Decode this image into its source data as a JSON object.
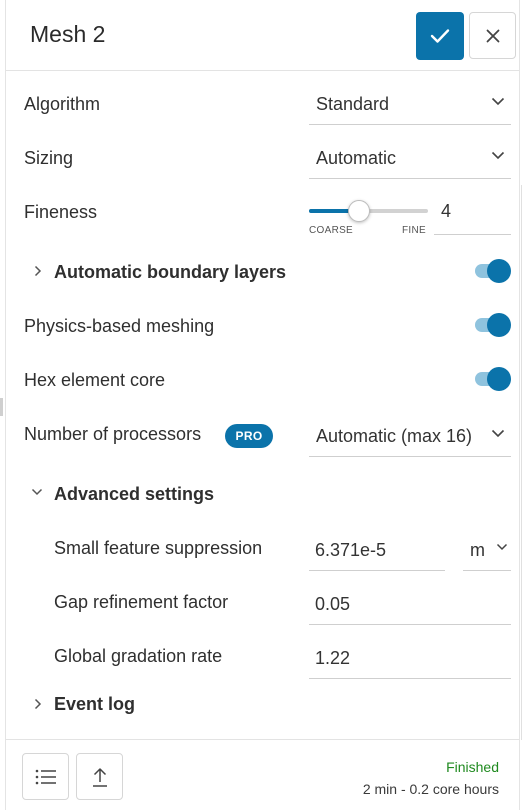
{
  "header": {
    "title": "Mesh 2",
    "confirm_icon": "check-icon",
    "close_icon": "close-icon"
  },
  "colors": {
    "accent": "#0b73aa",
    "toggle_track": "#8fc3de",
    "status_success": "#1f8a1f"
  },
  "form": {
    "algorithm": {
      "label": "Algorithm",
      "value": "Standard"
    },
    "sizing": {
      "label": "Sizing",
      "value": "Automatic"
    },
    "fineness": {
      "label": "Fineness",
      "value": "4",
      "min_label": "COARSE",
      "max_label": "FINE",
      "slider_fraction": 0.42
    },
    "boundary_layers": {
      "label": "Automatic boundary layers",
      "enabled": true,
      "expanded": false
    },
    "physics_meshing": {
      "label": "Physics-based meshing",
      "enabled": true
    },
    "hex_core": {
      "label": "Hex element core",
      "enabled": true
    },
    "processors": {
      "label": "Number of processors",
      "badge": "PRO",
      "value": "Automatic (max 16)"
    }
  },
  "advanced": {
    "label": "Advanced settings",
    "expanded": true,
    "small_feature": {
      "label": "Small feature suppression",
      "value": "6.371e-5",
      "unit": "m"
    },
    "gap_refinement": {
      "label": "Gap refinement factor",
      "value": "0.05"
    },
    "gradation_rate": {
      "label": "Global gradation rate",
      "value": "1.22"
    }
  },
  "event_log": {
    "label": "Event log",
    "expanded": false
  },
  "footer": {
    "list_icon": "list-icon",
    "upload_icon": "upload-icon",
    "status": "Finished",
    "cost": "2 min - 0.2 core hours"
  }
}
